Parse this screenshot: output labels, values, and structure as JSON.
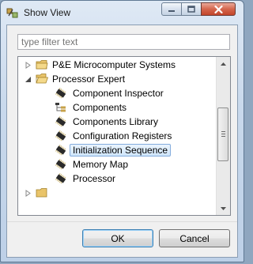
{
  "window": {
    "title": "Show View"
  },
  "filter": {
    "placeholder": "type filter text",
    "value": ""
  },
  "tree": {
    "items": [
      {
        "label": "P&E Microcomputer Systems",
        "type": "folder",
        "expanded": false,
        "indent": 0
      },
      {
        "label": "Processor Expert",
        "type": "folder",
        "expanded": true,
        "indent": 0
      },
      {
        "label": "Component Inspector",
        "type": "view",
        "indent": 1
      },
      {
        "label": "Components",
        "type": "view",
        "indent": 1
      },
      {
        "label": "Components Library",
        "type": "view",
        "indent": 1
      },
      {
        "label": "Configuration Registers",
        "type": "view",
        "indent": 1
      },
      {
        "label": "Initialization Sequence",
        "type": "view",
        "indent": 1,
        "selected": true
      },
      {
        "label": "Memory Map",
        "type": "view",
        "indent": 1
      },
      {
        "label": "Processor",
        "type": "view",
        "indent": 1
      }
    ]
  },
  "buttons": {
    "ok": "OK",
    "cancel": "Cancel"
  }
}
